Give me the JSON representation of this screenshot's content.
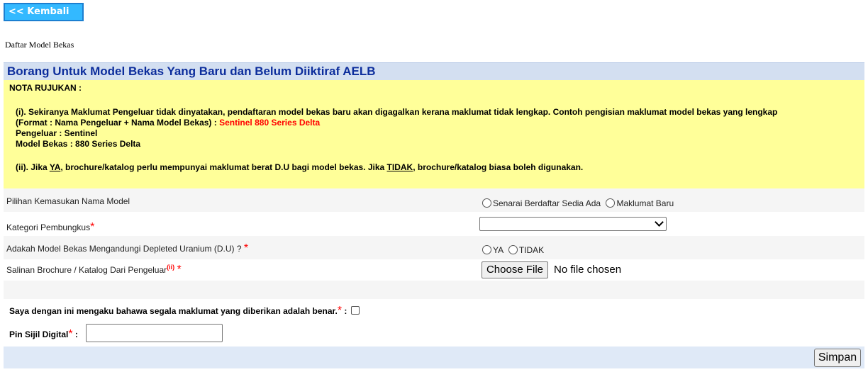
{
  "back_button": {
    "label": "<< Kembali"
  },
  "page_heading": "Daftar Model Bekas",
  "form": {
    "title": "Borang Untuk Model Bekas Yang Baru dan Belum Diiktiraf AELB",
    "notes": {
      "heading": "NOTA RUJUKAN :",
      "note1_line1": "(i). Sekiranya Maklumat Pengeluar tidak dinyatakan, pendaftaran model bekas baru akan digagalkan kerana maklumat tidak lengkap. Contoh pengisian maklumat model bekas yang lengkap",
      "note1_line2_prefix": "(Format : Nama Pengeluar + Nama Model Bekas) : ",
      "note1_example": "Sentinel 880 Series Delta",
      "note1_line3": "Pengeluar : Sentinel",
      "note1_line4": "Model Bekas : 880 Series Delta",
      "note2_a": "(ii). Jika ",
      "note2_yes": "YA",
      "note2_b": ", brochure/katalog perlu mempunyai maklumat berat D.U bagi model bekas. Jika ",
      "note2_no": "TIDAK",
      "note2_c": ", brochure/katalog biasa boleh digunakan."
    },
    "fields": {
      "model_name_choice": {
        "label": "Pilihan Kemasukan Nama Model",
        "options": [
          "Senarai Berdaftar Sedia Ada",
          "Maklumat Baru"
        ]
      },
      "packaging_category": {
        "label": "Kategori Pembungkus",
        "required": "*",
        "value": ""
      },
      "depleted_uranium": {
        "label": "Adakah Model Bekas Mengandungi Depleted Uranium (D.U) ?",
        "required": "*",
        "options": [
          "YA",
          "TIDAK"
        ]
      },
      "brochure": {
        "label": "Salinan Brochure / Katalog Dari Pengeluar",
        "sup": "(ii)",
        "required": "*",
        "button": "Choose File",
        "status": "No file chosen"
      }
    },
    "declaration": {
      "text": "Saya dengan ini mengaku bahawa segala maklumat yang diberikan adalah benar.",
      "required": "*",
      "suffix": " :"
    },
    "pin": {
      "label": "Pin Sijil Digital",
      "required": "*",
      "suffix": " :",
      "value": ""
    },
    "save_button": "Simpan"
  }
}
